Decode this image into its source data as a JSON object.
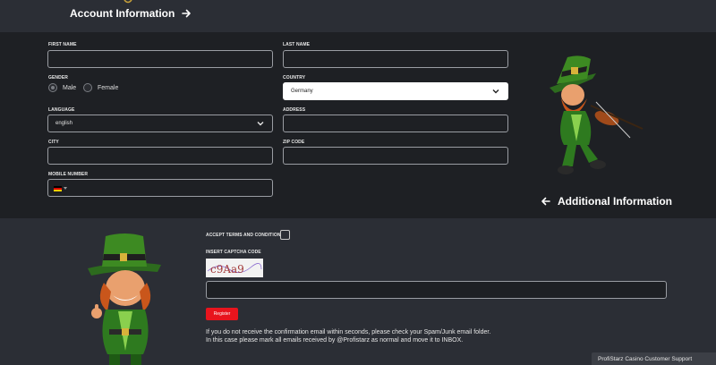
{
  "account": {
    "title": "Account Information"
  },
  "additional": {
    "title": "Additional Information"
  },
  "form": {
    "first_name_label": "FIRST NAME",
    "last_name_label": "LAST NAME",
    "gender_label": "GENDER",
    "gender_male": "Male",
    "gender_female": "Female",
    "country_label": "COUNTRY",
    "country_value": "Germany",
    "language_label": "LANGUAGE",
    "language_value": "english",
    "address_label": "ADDRESS",
    "city_label": "CITY",
    "zip_label": "ZIP CODE",
    "mobile_label": "MOBILE NUMBER",
    "mobile_flag": "DE"
  },
  "register": {
    "terms_label": "ACCEPT TERMS AND CONDITIONS",
    "captcha_label": "INSERT CAPTCHA CODE",
    "captcha_text": "c9Aa9",
    "button_label": "Register",
    "note_line1": "If you do not receive the confirmation email within seconds, please check your Spam/Junk email folder.",
    "note_line2": "In this case please mark all emails received by @Profistarz as normal and move it to INBOX."
  },
  "support": {
    "label": "ProfiStarz Casino Customer Support"
  },
  "icons": {
    "arrow_right": "arrow-right-icon",
    "arrow_left": "arrow-left-icon",
    "chevron": "chevron-down-icon"
  },
  "colors": {
    "accent_red": "#e8141d",
    "form_bg": "#1e2024",
    "page_bg": "#2b2e35"
  }
}
